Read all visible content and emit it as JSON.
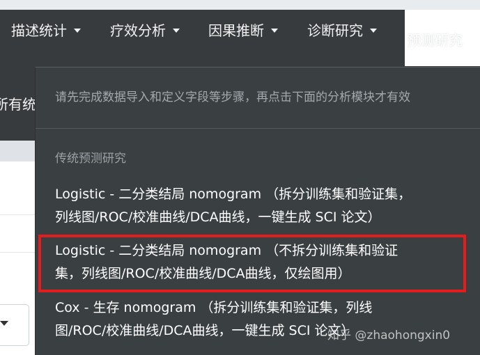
{
  "nav": {
    "items": [
      {
        "label": "描述统计"
      },
      {
        "label": "疗效分析"
      },
      {
        "label": "因果推断"
      },
      {
        "label": "诊断研究"
      }
    ],
    "active_label": "预测研究"
  },
  "subnav_fragment": "所有统",
  "dropdown": {
    "note": "请先完成数据导入和定义字段等步骤，再点击下面的分析模块才有效",
    "section_header": "传统预测研究",
    "items": [
      {
        "line1": "Logistic - 二分类结局 nomogram （拆分训练集和验证集，",
        "line2": "列线图/ROC/校准曲线/DCA曲线，一键生成 SCI 论文）"
      },
      {
        "line1": "Logistic - 二分类结局 nomogram （不拆分训练集和验证",
        "line2": "集，列线图/ROC/校准曲线/DCA曲线，仅绘图用）"
      },
      {
        "line1": "Cox - 生存 nomogram （拆分训练集和验证集，列线",
        "line2": "图/ROC/校准曲线/DCA曲线，一键生成 SCI 论文）"
      }
    ]
  },
  "watermark": "知乎 @zhaohongxin0",
  "colors": {
    "navbar": "#373b3e",
    "dropdown": "#3a3f42",
    "highlight": "#e31d1d"
  }
}
